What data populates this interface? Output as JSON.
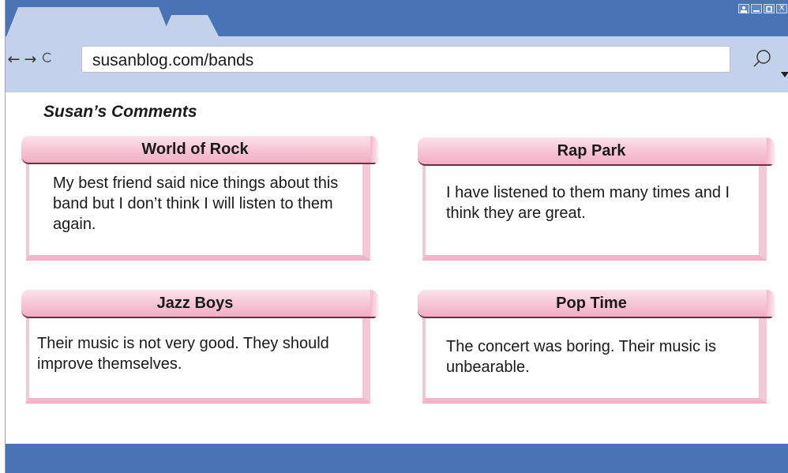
{
  "window": {
    "controls": [
      "user-icon",
      "minimize-icon",
      "maximize-icon",
      "close-icon"
    ],
    "close_label": "X"
  },
  "toolbar": {
    "back_icon": "←",
    "forward_icon": "→",
    "reload_icon": "C",
    "url": "susanblog.com/bands",
    "search_icon": "search-icon"
  },
  "page": {
    "title": "Susan’s Comments"
  },
  "cards": [
    {
      "title": "World of Rock",
      "text": "My best friend said nice things about this band but I don’t think I will listen to them again."
    },
    {
      "title": "Rap Park",
      "text": "I have listened to them many times and I think they are great."
    },
    {
      "title": "Jazz Boys",
      "text": "Their music is not very good. They should improve themselves."
    },
    {
      "title": "Pop Time",
      "text": "The concert was boring. Their music is unbearable."
    }
  ],
  "colors": {
    "chrome": "#4a73b5",
    "toolbar": "#c3d2ea",
    "card_header": "#f6c4d4",
    "card_border": "#f4c7d6"
  }
}
